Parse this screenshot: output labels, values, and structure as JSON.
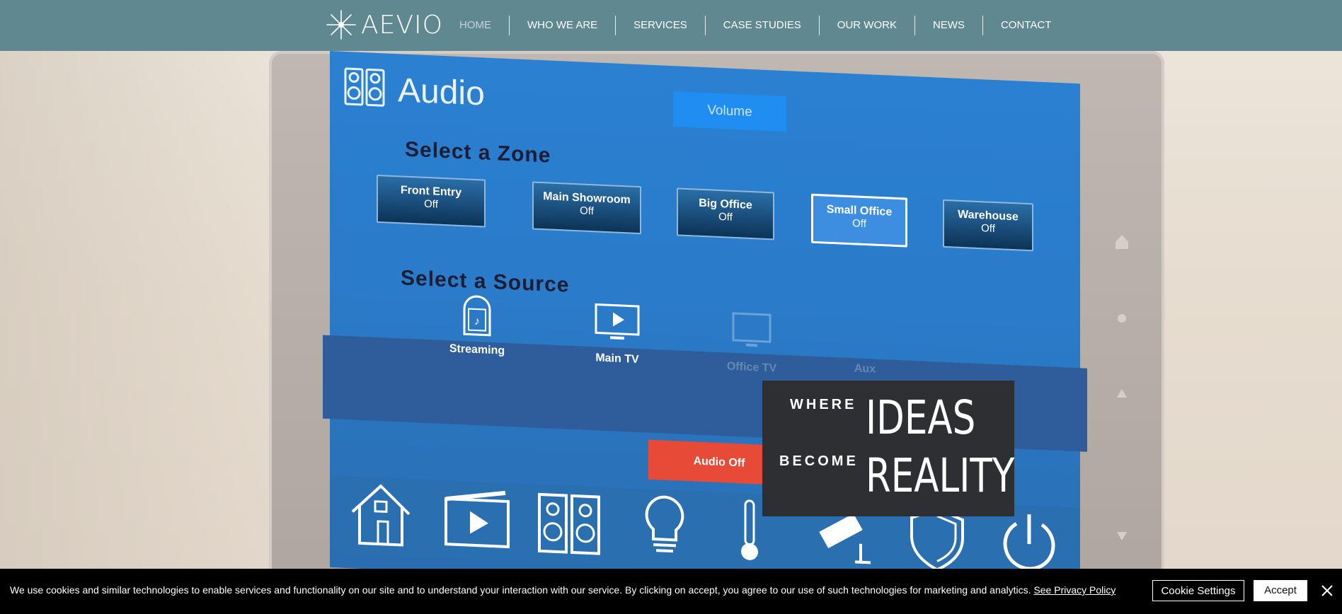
{
  "nav": {
    "logo_text": "AEVIO",
    "items": [
      {
        "label": "HOME",
        "active": true
      },
      {
        "label": "WHO WE ARE",
        "active": false
      },
      {
        "label": "SERVICES",
        "active": false
      },
      {
        "label": "CASE STUDIES",
        "active": false
      },
      {
        "label": "OUR WORK",
        "active": false
      },
      {
        "label": "NEWS",
        "active": false
      },
      {
        "label": "CONTACT",
        "active": false
      }
    ],
    "colors": {
      "bar": "#5f8890",
      "active_text": "#c6d4d7"
    }
  },
  "hero": {
    "panel": {
      "title": "Audio",
      "volume_label": "Volume",
      "zone_section": "Select a Zone",
      "source_section": "Select a Source",
      "zones": [
        {
          "name": "Front Entry",
          "state": "Off"
        },
        {
          "name": "Main Showroom",
          "state": "Off"
        },
        {
          "name": "Big Office",
          "state": "Off"
        },
        {
          "name": "Small Office",
          "state": "Off",
          "selected": true
        },
        {
          "name": "Warehouse",
          "state": "Off"
        }
      ],
      "sources": [
        {
          "label": "Streaming",
          "icon": "jukebox-icon"
        },
        {
          "label": "Main TV",
          "icon": "tv-play-icon"
        },
        {
          "label": "Office TV",
          "icon": "monitor-icon"
        },
        {
          "label": "Aux",
          "icon": "aux-icon"
        }
      ],
      "audio_off_label": "Audio Off",
      "bottom_icons": [
        "home-icon",
        "video-icon",
        "speakers-icon",
        "lightbulb-icon",
        "thermometer-icon",
        "camera-icon",
        "shield-icon",
        "power-icon"
      ]
    },
    "tagline": {
      "where": "WHERE",
      "ideas": "IDEAS",
      "become": "BECOME",
      "reality": "REALITY"
    }
  },
  "cookie_banner": {
    "message": "We use cookies and similar technologies to enable services and functionality on our site and to understand your interaction with our service. By clicking on accept, you agree to our use of such technologies for marketing and analytics.",
    "privacy_link": "See Privacy Policy",
    "settings_label": "Cookie Settings",
    "accept_label": "Accept"
  }
}
